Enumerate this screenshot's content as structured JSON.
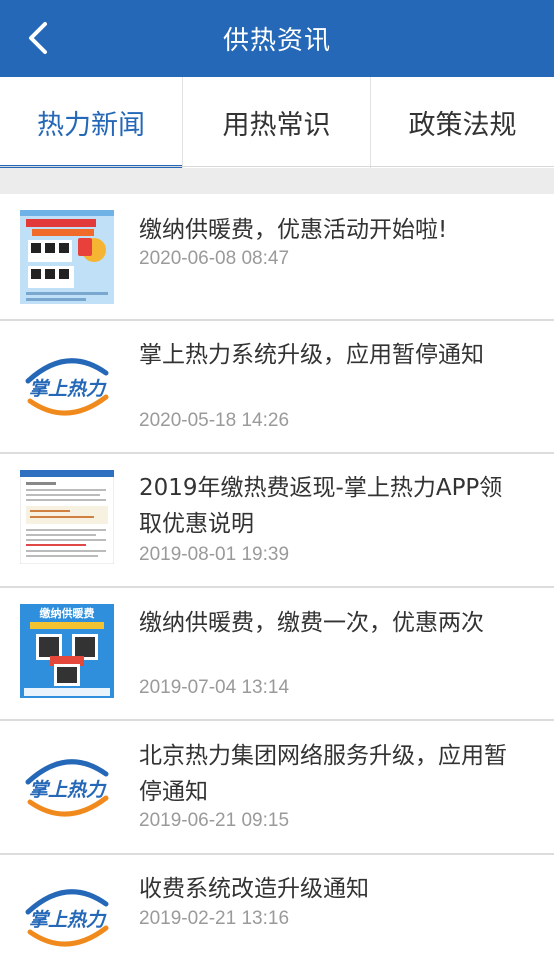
{
  "header": {
    "title": "供热资讯"
  },
  "tabs": [
    {
      "label": "热力新闻",
      "active": true
    },
    {
      "label": "用热常识",
      "active": false
    },
    {
      "label": "政策法规",
      "active": false
    }
  ],
  "news": [
    {
      "title": "缴纳供暖费，优惠活动开始啦!",
      "date": "2020-06-08 08:47",
      "thumb": "promo-poster-image"
    },
    {
      "title": "掌上热力系统升级，应用暂停通知",
      "date": "2020-05-18 14:26",
      "thumb": "zhangshangreli-logo",
      "thumb_text": "掌上热力"
    },
    {
      "title": "2019年缴热费返现-掌上热力APP领取优惠说明",
      "date": "2019-08-01 19:39",
      "thumb": "document-screenshot-image"
    },
    {
      "title": "缴纳供暖费，缴费一次，优惠两次",
      "date": "2019-07-04 13:14",
      "thumb": "payment-poster-image",
      "thumb_text": "缴纳供暖费"
    },
    {
      "title": "北京热力集团网络服务升级，应用暂停通知",
      "date": "2019-06-21 09:15",
      "thumb": "zhangshangreli-logo",
      "thumb_text": "掌上热力"
    },
    {
      "title": "收费系统改造升级通知",
      "date": "2019-02-21 13:16",
      "thumb": "zhangshangreli-logo",
      "thumb_text": "掌上热力"
    }
  ],
  "colors": {
    "primary": "#2568b8",
    "divider": "#dcdcdc",
    "date": "#9a9a9a",
    "logo_orange": "#f08a1c"
  }
}
